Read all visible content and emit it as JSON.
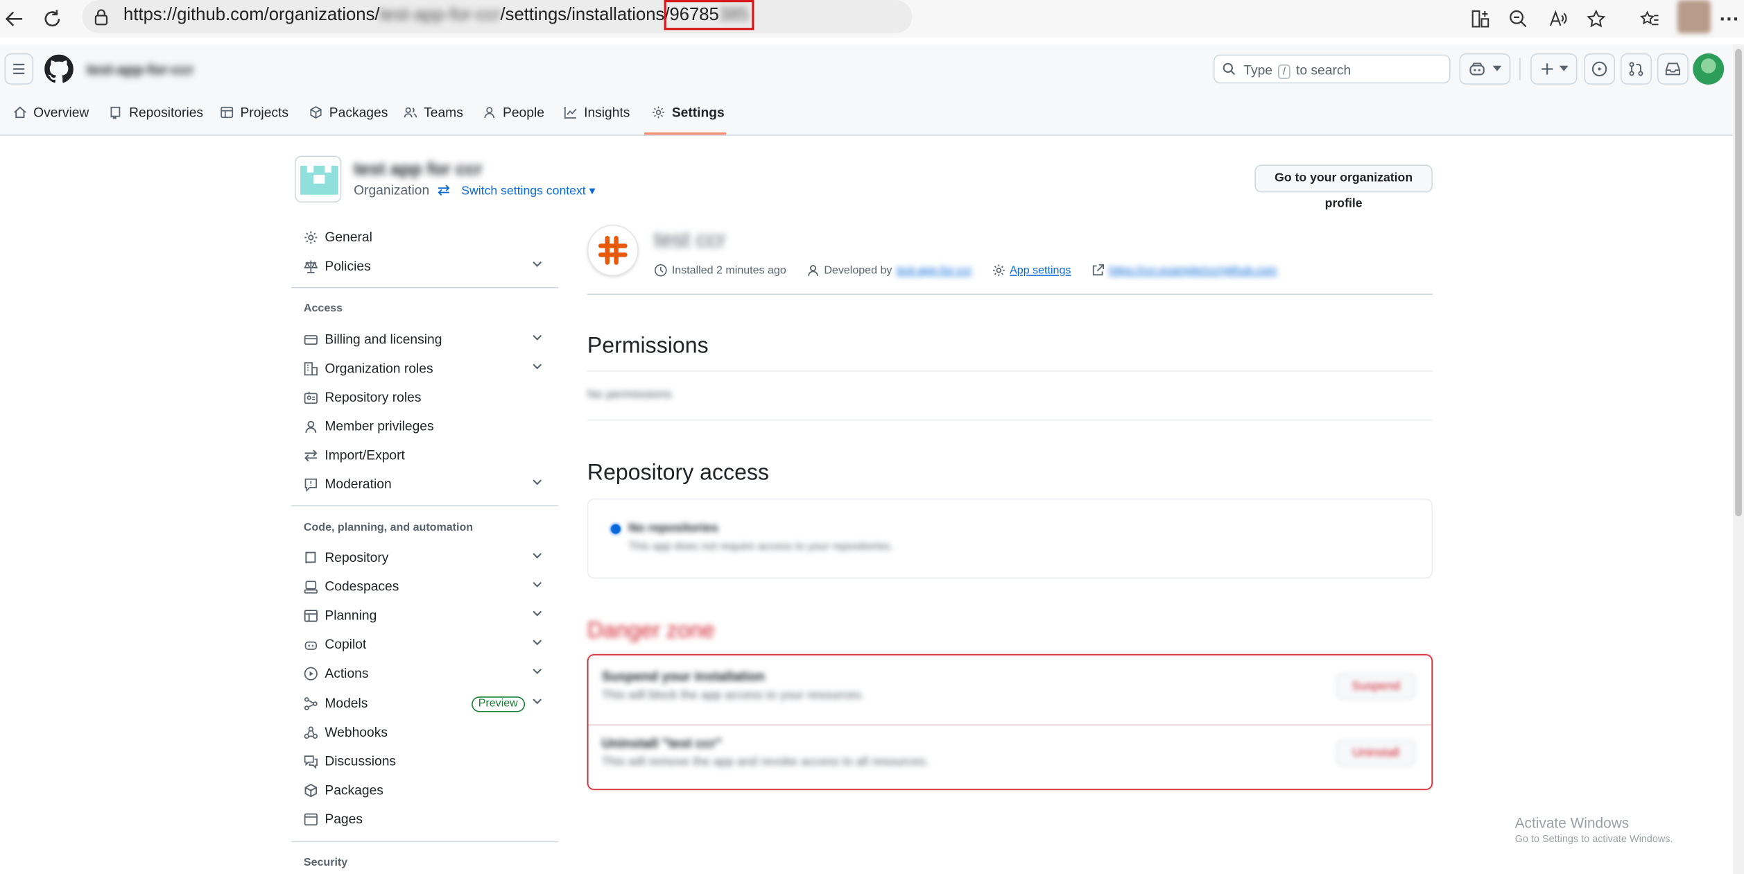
{
  "browser": {
    "url_prefix": "https://github.com/organizations/",
    "url_org_blurred": "test-app-for-ccr",
    "url_mid": "/settings/installations/",
    "url_id_visible": "96785",
    "url_id_blurred": "385"
  },
  "header": {
    "org_name": "test-app-for-ccr",
    "search_before": "Type",
    "search_key": "/",
    "search_after": "to search"
  },
  "orgnav": {
    "tabs": [
      {
        "label": "Overview"
      },
      {
        "label": "Repositories"
      },
      {
        "label": "Projects"
      },
      {
        "label": "Packages"
      },
      {
        "label": "Teams"
      },
      {
        "label": "People"
      },
      {
        "label": "Insights"
      },
      {
        "label": "Settings"
      }
    ],
    "selected": "Settings"
  },
  "context": {
    "org_title": "test app for ccr",
    "org_type": "Organization",
    "switch_label": "Switch settings context",
    "profile_button": "Go to your organization profile"
  },
  "sidebar": {
    "general": "General",
    "policies": "Policies",
    "access_heading": "Access",
    "access": [
      "Billing and licensing",
      "Organization roles",
      "Repository roles",
      "Member privileges",
      "Import/Export",
      "Moderation"
    ],
    "code_heading": "Code, planning, and automation",
    "code": [
      "Repository",
      "Codespaces",
      "Planning",
      "Copilot",
      "Actions",
      "Models",
      "Webhooks",
      "Discussions",
      "Packages",
      "Pages"
    ],
    "preview_badge": "Preview",
    "security_heading": "Security"
  },
  "app": {
    "name": "test ccr",
    "installed": "Installed 2 minutes ago",
    "developed_by": "Developed by",
    "developer": "test-app-for-ccr",
    "app_settings": "App settings",
    "homepage": "https://ccr.example/ccr/github.com"
  },
  "permissions": {
    "heading": "Permissions",
    "none_text": "No permissions"
  },
  "repo_access": {
    "heading": "Repository access",
    "option_title": "No repositories",
    "option_desc": "This app does not require access to your repositories."
  },
  "danger": {
    "heading": "Danger zone",
    "suspend_title": "Suspend your installation",
    "suspend_desc": "This will block the app access to your resources.",
    "suspend_button": "Suspend",
    "uninstall_title": "Uninstall \"test ccr\"",
    "uninstall_desc": "This will remove the app and revoke access to all resources.",
    "uninstall_button": "Uninstall"
  },
  "watermark": {
    "line1": "Activate Windows",
    "line2": "Go to Settings to activate Windows."
  },
  "colors": {
    "accent": "#0969da",
    "tab_underline": "#fd8c73",
    "danger": "#d1242f",
    "app_logo": "#e8590c"
  }
}
